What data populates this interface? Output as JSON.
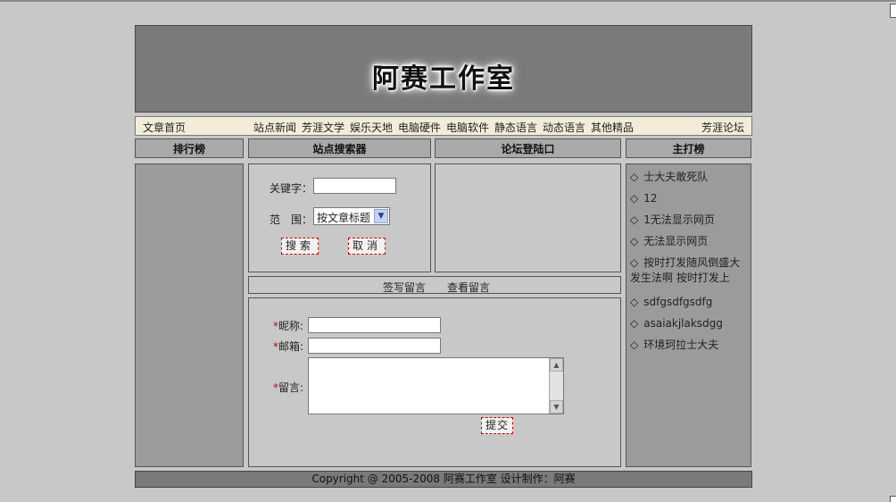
{
  "banner": {
    "title": "阿赛工作室"
  },
  "nav": {
    "home": "文章首页",
    "items": [
      "站点新闻",
      "芳涯文学",
      "娱乐天地",
      "电脑硬件",
      "电脑软件",
      "静态语言",
      "动态语言",
      "其他精品"
    ],
    "forum": "芳涯论坛"
  },
  "columns": {
    "ranking": "排行榜",
    "search": "站点搜索器",
    "login": "论坛登陆口",
    "featured": "主打榜"
  },
  "search": {
    "keyword_label": "关键字：",
    "keyword_value": "",
    "scope_label": "范　围：",
    "scope_value": "按文章标题",
    "search_button": "搜索",
    "cancel_button": "取消"
  },
  "guestbook_links": {
    "write": "签写留言",
    "view": "查看留言"
  },
  "guestbook": {
    "required_mark": "*",
    "nickname_label": "昵称:",
    "email_label": "邮箱:",
    "message_label": "留言:",
    "submit": "提交"
  },
  "featured_items": [
    "士大夫敢死队",
    "12",
    "1无法显示网页",
    "无法显示网页",
    "按时打发随风倒盛大发生法啊 按时打发上",
    "sdfgsdfgsdfg",
    "asaiakjlaksdgg",
    "环境珂拉士大夫"
  ],
  "featured_bullet": "◇",
  "icons": {
    "select_arrow": "chevron-down-icon",
    "scroll_up": "arrow-up-icon",
    "scroll_down": "arrow-down-icon"
  },
  "footer": {
    "copyright": "Copyright @ 2005-2008 阿赛工作室 设计制作：阿赛"
  },
  "colors": {
    "background": "#c8c8c8",
    "banner": "#7a7a7a",
    "nav_bg": "#f3ecd9",
    "button_border": "#cc0000"
  }
}
